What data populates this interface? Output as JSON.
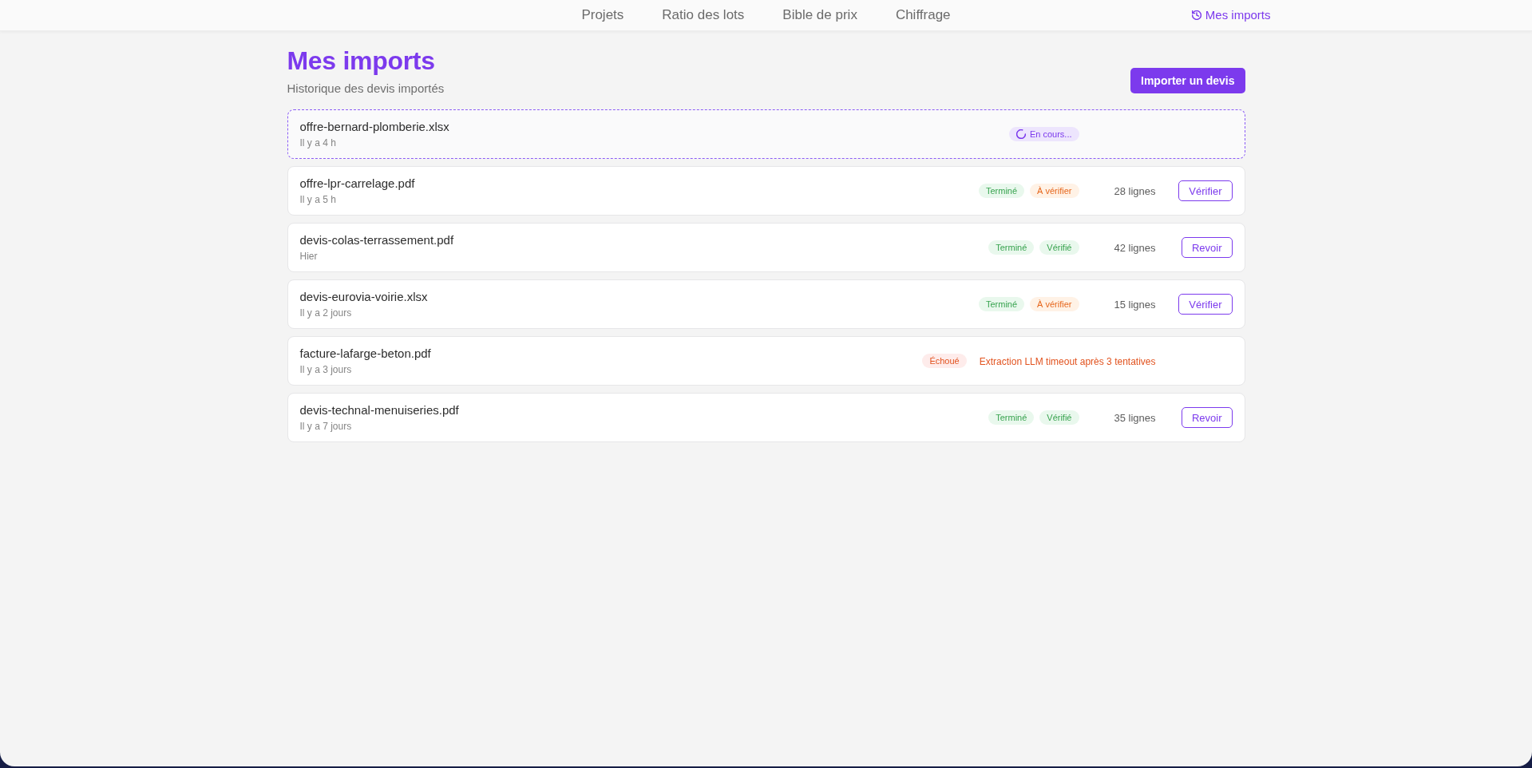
{
  "nav": {
    "links": [
      {
        "label": "Projets",
        "selected": false
      },
      {
        "label": "Ratio des lots",
        "selected": false
      },
      {
        "label": "Bible de prix",
        "selected": false
      },
      {
        "label": "Chiffrage",
        "selected": false
      }
    ],
    "imports_link": {
      "label": "Mes imports",
      "selected": true
    }
  },
  "header": {
    "title": "Mes imports",
    "subtitle": "Historique des devis importés",
    "import_button": "Importer un devis"
  },
  "imports": [
    {
      "file": "offre-bernard-plomberie.xlsx",
      "time": "Il y a 4 h",
      "processing": true,
      "badges": [
        {
          "label": "En cours...",
          "kind": "progress"
        }
      ]
    },
    {
      "file": "offre-lpr-carrelage.pdf",
      "time": "Il y a 5 h",
      "processing": false,
      "badges": [
        {
          "label": "Terminé",
          "kind": "success"
        },
        {
          "label": "À vérifier",
          "kind": "warning"
        }
      ],
      "lines": "28 lignes",
      "action": "Vérifier"
    },
    {
      "file": "devis-colas-terrassement.pdf",
      "time": "Hier",
      "processing": false,
      "badges": [
        {
          "label": "Terminé",
          "kind": "success"
        },
        {
          "label": "Vérifié",
          "kind": "success"
        }
      ],
      "lines": "42 lignes",
      "action": "Revoir"
    },
    {
      "file": "devis-eurovia-voirie.xlsx",
      "time": "Il y a 2 jours",
      "processing": false,
      "badges": [
        {
          "label": "Terminé",
          "kind": "success"
        },
        {
          "label": "À vérifier",
          "kind": "warning"
        }
      ],
      "lines": "15 lignes",
      "action": "Vérifier"
    },
    {
      "file": "facture-lafarge-beton.pdf",
      "time": "Il y a 3 jours",
      "processing": false,
      "badges": [
        {
          "label": "Échoué",
          "kind": "error"
        }
      ],
      "error": "Extraction LLM timeout après 3 tentatives"
    },
    {
      "file": "devis-technal-menuiseries.pdf",
      "time": "Il y a 7 jours",
      "processing": false,
      "badges": [
        {
          "label": "Terminé",
          "kind": "success"
        },
        {
          "label": "Vérifié",
          "kind": "success"
        }
      ],
      "lines": "35 lignes",
      "action": "Revoir"
    }
  ]
}
